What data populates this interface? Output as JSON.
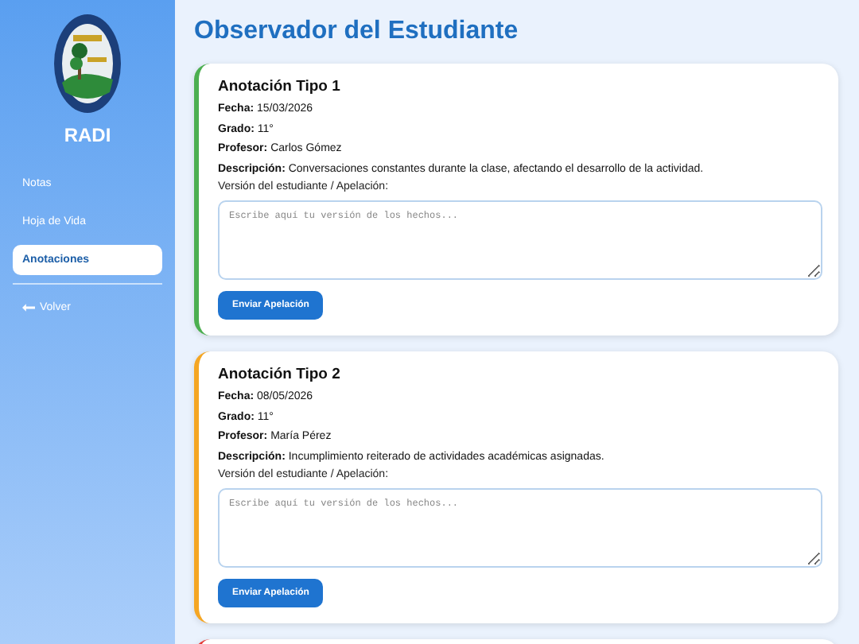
{
  "sidebar": {
    "brand": "RADI",
    "items": [
      {
        "label": "Notas",
        "selected": false,
        "kind": "link"
      },
      {
        "label": "Hoja de Vida",
        "selected": false,
        "kind": "link"
      },
      {
        "label": "Anotaciones",
        "selected": true,
        "kind": "link"
      },
      {
        "label": "Volver",
        "selected": false,
        "kind": "back"
      }
    ]
  },
  "title": "Observador del Estudiante",
  "annotations": [
    {
      "color": "#4caf50",
      "heading": "Anotación Tipo 1",
      "fields": [
        {
          "label": "Fecha:",
          "value": "15/03/2026"
        },
        {
          "label": "Grado:",
          "value": "11°"
        },
        {
          "label": "Profesor:",
          "value": "Carlos Gómez"
        },
        {
          "label": "Descripción:",
          "value": "Conversaciones constantes durante la clase, afectando el desarrollo de la actividad."
        }
      ],
      "appeal_label": "Versión del estudiante / Apelación:",
      "placeholder": "Escribe aquí tu versión de los hechos...",
      "button": "Enviar Apelación"
    },
    {
      "color": "#f5a623",
      "heading": "Anotación Tipo 2",
      "fields": [
        {
          "label": "Fecha:",
          "value": "08/05/2026"
        },
        {
          "label": "Grado:",
          "value": "11°"
        },
        {
          "label": "Profesor:",
          "value": "María Pérez"
        },
        {
          "label": "Descripción:",
          "value": "Incumplimiento reiterado de actividades académicas asignadas."
        }
      ],
      "appeal_label": "Versión del estudiante / Apelación:",
      "placeholder": "Escribe aquí tu versión de los hechos...",
      "button": "Enviar Apelación"
    },
    {
      "color": "#e53935"
    }
  ]
}
